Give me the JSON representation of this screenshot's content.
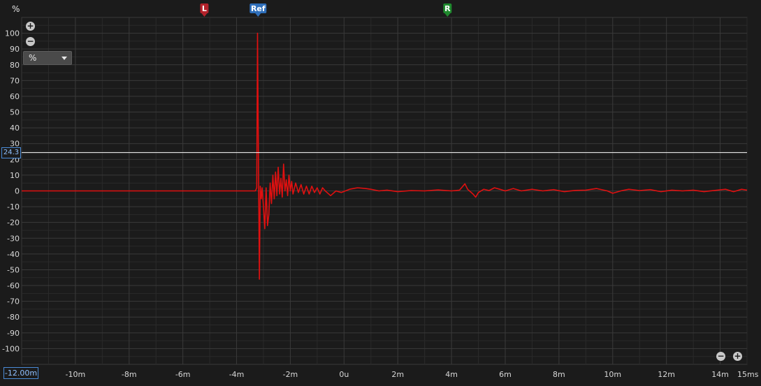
{
  "y_unit_label": "%",
  "unit_select": {
    "value": "%"
  },
  "cursor_value": "24.3",
  "start_time": "-12.00m",
  "markers": [
    {
      "label": "L",
      "x": -5.2,
      "color": "#b3222b"
    },
    {
      "label": "Ref",
      "x": -3.2,
      "color": "#2f6fba"
    },
    {
      "label": "R",
      "x": 3.85,
      "color": "#1f8a2e"
    }
  ],
  "zoom_icons": [
    "zoom-in-icon",
    "zoom-out-icon"
  ],
  "colors": {
    "trace": "#e01010",
    "cursor_line": "#ffffff",
    "grid": "#3a3a3a",
    "background": "#1b1b1b"
  },
  "chart_data": {
    "type": "line",
    "title": "",
    "xlabel": "",
    "ylabel": "%",
    "xlim": [
      -12.0,
      15.0
    ],
    "ylim": [
      -110,
      110
    ],
    "x_ticks": [
      {
        "v": -10,
        "label": "-10m"
      },
      {
        "v": -8,
        "label": "-8m"
      },
      {
        "v": -6,
        "label": "-6m"
      },
      {
        "v": -4,
        "label": "-4m"
      },
      {
        "v": -2,
        "label": "-2m"
      },
      {
        "v": 0,
        "label": "0u"
      },
      {
        "v": 2,
        "label": "2m"
      },
      {
        "v": 4,
        "label": "4m"
      },
      {
        "v": 6,
        "label": "6m"
      },
      {
        "v": 8,
        "label": "8m"
      },
      {
        "v": 10,
        "label": "10m"
      },
      {
        "v": 12,
        "label": "12m"
      },
      {
        "v": 14,
        "label": "14m"
      },
      {
        "v": 15,
        "label": "15ms"
      }
    ],
    "y_ticks": [
      100,
      90,
      80,
      70,
      60,
      50,
      40,
      30,
      20,
      10,
      0,
      -10,
      -20,
      -30,
      -40,
      -50,
      -60,
      -70,
      -80,
      -90,
      -100
    ],
    "cursor_y": 24.3,
    "grid": true,
    "series": [
      {
        "color": "#e01010",
        "points": [
          [
            -12.0,
            0
          ],
          [
            -3.3,
            0
          ],
          [
            -3.25,
            2
          ],
          [
            -3.22,
            100
          ],
          [
            -3.18,
            5
          ],
          [
            -3.15,
            -56
          ],
          [
            -3.12,
            3
          ],
          [
            -3.08,
            -5
          ],
          [
            -3.05,
            2
          ],
          [
            -3.0,
            -10
          ],
          [
            -2.95,
            -24
          ],
          [
            -2.9,
            2
          ],
          [
            -2.85,
            -22
          ],
          [
            -2.8,
            -15
          ],
          [
            -2.75,
            5
          ],
          [
            -2.7,
            -8
          ],
          [
            -2.65,
            10
          ],
          [
            -2.6,
            -5
          ],
          [
            -2.55,
            12
          ],
          [
            -2.5,
            -3
          ],
          [
            -2.45,
            15
          ],
          [
            -2.4,
            -2
          ],
          [
            -2.35,
            8
          ],
          [
            -2.3,
            -4
          ],
          [
            -2.25,
            17
          ],
          [
            -2.2,
            0
          ],
          [
            -2.15,
            7
          ],
          [
            -2.1,
            -3
          ],
          [
            -2.05,
            10
          ],
          [
            -2.0,
            0
          ],
          [
            -1.95,
            6
          ],
          [
            -1.9,
            -2
          ],
          [
            -1.8,
            5
          ],
          [
            -1.7,
            -1
          ],
          [
            -1.6,
            4
          ],
          [
            -1.5,
            -2
          ],
          [
            -1.4,
            3
          ],
          [
            -1.3,
            -2
          ],
          [
            -1.2,
            3
          ],
          [
            -1.1,
            -1
          ],
          [
            -1.0,
            2
          ],
          [
            -0.9,
            -2
          ],
          [
            -0.8,
            2
          ],
          [
            -0.7,
            0
          ],
          [
            -0.5,
            -3
          ],
          [
            -0.3,
            0
          ],
          [
            -0.1,
            -1
          ],
          [
            0.2,
            1
          ],
          [
            0.5,
            2
          ],
          [
            0.8,
            1.5
          ],
          [
            1.0,
            1
          ],
          [
            1.3,
            0
          ],
          [
            1.6,
            0.5
          ],
          [
            2.0,
            -0.5
          ],
          [
            2.5,
            0.2
          ],
          [
            3.0,
            0
          ],
          [
            3.5,
            0.6
          ],
          [
            4.0,
            0
          ],
          [
            4.3,
            0.5
          ],
          [
            4.5,
            4.5
          ],
          [
            4.6,
            1
          ],
          [
            4.8,
            -2
          ],
          [
            4.9,
            -4
          ],
          [
            5.0,
            -1
          ],
          [
            5.2,
            1
          ],
          [
            5.4,
            0.2
          ],
          [
            5.6,
            2
          ],
          [
            5.8,
            1
          ],
          [
            6.0,
            0
          ],
          [
            6.3,
            1.5
          ],
          [
            6.6,
            0
          ],
          [
            7.0,
            1
          ],
          [
            7.4,
            0
          ],
          [
            7.8,
            0.8
          ],
          [
            8.2,
            -0.5
          ],
          [
            8.6,
            0.3
          ],
          [
            9.0,
            0.5
          ],
          [
            9.4,
            1.5
          ],
          [
            9.8,
            0
          ],
          [
            10.0,
            -1.5
          ],
          [
            10.3,
            0
          ],
          [
            10.6,
            1
          ],
          [
            11.0,
            0.2
          ],
          [
            11.4,
            0.8
          ],
          [
            11.8,
            -0.5
          ],
          [
            12.2,
            0.5
          ],
          [
            12.6,
            0
          ],
          [
            13.0,
            0.5
          ],
          [
            13.4,
            -0.5
          ],
          [
            13.8,
            0.3
          ],
          [
            14.2,
            1
          ],
          [
            14.5,
            -0.5
          ],
          [
            14.8,
            1
          ],
          [
            15.0,
            0.5
          ]
        ]
      }
    ]
  }
}
